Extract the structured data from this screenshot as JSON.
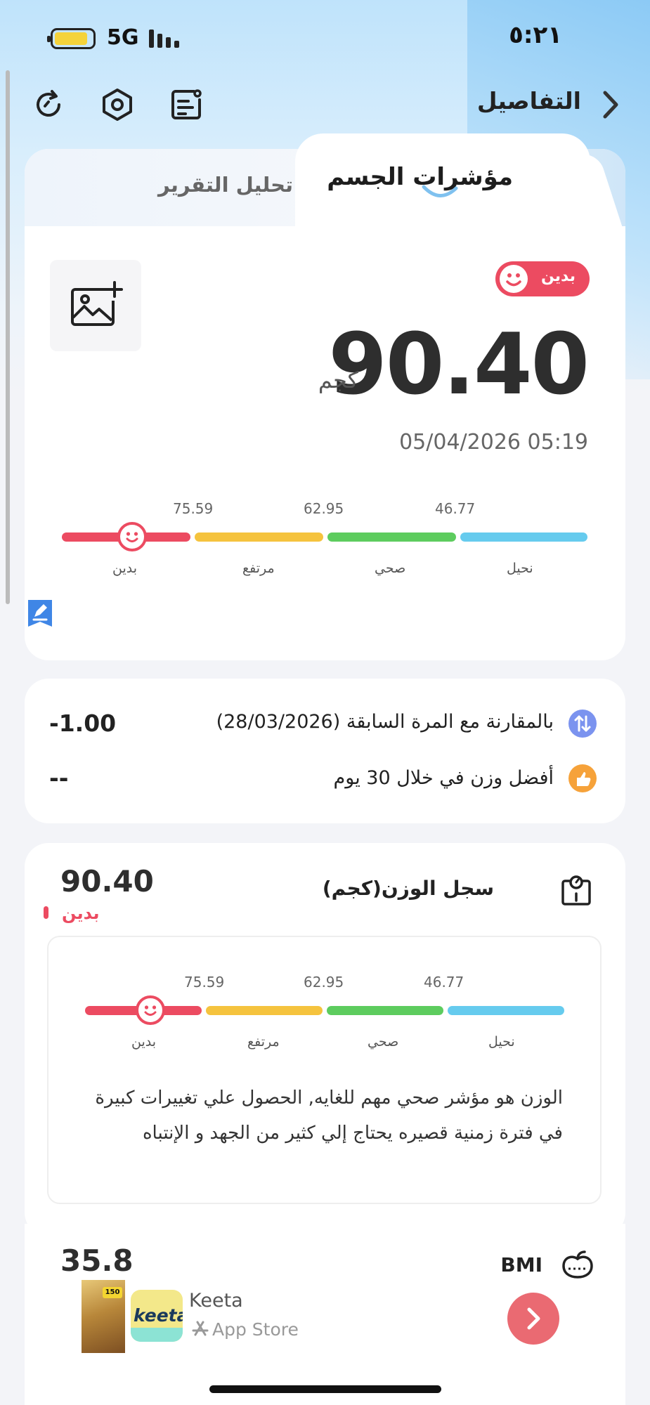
{
  "status_bar": {
    "time": "٥:٢١",
    "network": "5G"
  },
  "header": {
    "title": "التفاصيل",
    "icons": [
      "refresh-icon",
      "settings-icon",
      "notes-icon",
      "chevron-right-icon"
    ]
  },
  "tabs": [
    {
      "label": "مؤشرات الجسم",
      "active": true
    },
    {
      "label": "تحليل التقرير",
      "active": false
    }
  ],
  "summary": {
    "status": "بدين",
    "weight": "90.40",
    "unit": "كجم",
    "date": "05/04/2026 05:19"
  },
  "weight_scale": {
    "ticks": [
      "75.59",
      "62.95",
      "46.77"
    ],
    "labels": [
      "بدين",
      "مرتفع",
      "صحي",
      "نحيل"
    ],
    "colors": [
      "#ec4b61",
      "#f5c33e",
      "#5dcc5e",
      "#66cbee"
    ],
    "active_index": 0
  },
  "comparison": [
    {
      "text": "بالمقارنة مع المرة السابقة (28/03/2026)",
      "value": "-1.00",
      "icon": "compare-icon",
      "color": "#7b93ef"
    },
    {
      "text": "أفضل وزن في خلال 30 يوم",
      "value": "--",
      "icon": "thumbs-up-icon",
      "color": "#f6a23a"
    }
  ],
  "weight_record": {
    "title": "سجل الوزن(كجم)",
    "value": "90.40",
    "status": "بدين",
    "scale": {
      "ticks": [
        "75.59",
        "62.95",
        "46.77"
      ],
      "labels": [
        "بدين",
        "مرتفع",
        "صحي",
        "نحيل"
      ]
    },
    "description": "الوزن هو مؤشر صحي مهم للغايه, الحصول علي تغييرات كبيرة في فترة زمنية قصيره يحتاج إلي كثير من الجهد و الإنتباه"
  },
  "bmi": {
    "label": "BMI",
    "value": "35.8"
  },
  "ad": {
    "name": "Keeta",
    "store": "App Store",
    "logo_text": "keeta",
    "badge": "150"
  }
}
